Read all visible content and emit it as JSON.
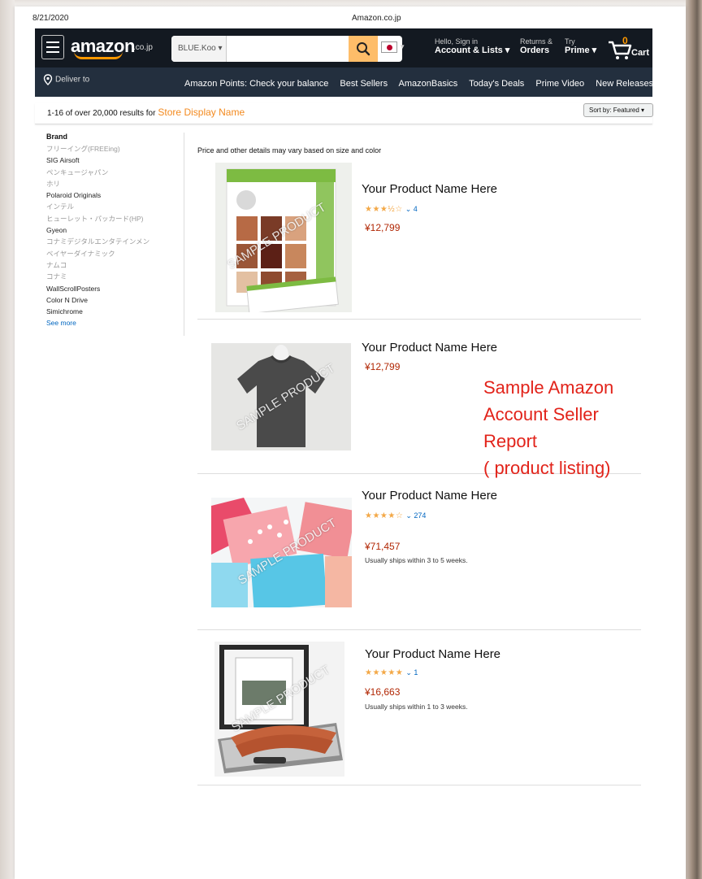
{
  "print_header": {
    "date": "8/21/2020",
    "title": "Amazon.co.jp"
  },
  "nav": {
    "logo": "amazon",
    "logo_tld": ".co.jp",
    "search_department": "BLUE.Koo ▾",
    "search_placeholder": "",
    "account_line1": "Hello, Sign in",
    "account_line2": "Account & Lists ▾",
    "orders_line1": "Returns &",
    "orders_line2": "Orders",
    "prime_line1": "Try",
    "prime_line2": "Prime ▾",
    "cart_count": "0",
    "cart_label": "Cart",
    "deliver_to": "Deliver to",
    "links": [
      "Amazon Points: Check your balance",
      "Best Sellers",
      "AmazonBasics",
      "Today's Deals",
      "Prime Video",
      "New Releases"
    ]
  },
  "results": {
    "summary": "1-16 of over 20,000 results for",
    "query": "Store Display Name",
    "sort_label": "Sort by: Featured ▾"
  },
  "sidebar": {
    "title": "Brand",
    "items": [
      {
        "label": "フリーイング(FREEing)",
        "tone": "light"
      },
      {
        "label": "SIG Airsoft",
        "tone": "dark"
      },
      {
        "label": "ペンキュージャパン",
        "tone": "light"
      },
      {
        "label": "ホリ",
        "tone": "light"
      },
      {
        "label": "Polaroid Originals",
        "tone": "dark"
      },
      {
        "label": "インテル",
        "tone": "light"
      },
      {
        "label": "ヒューレット・パッカード(HP)",
        "tone": "light"
      },
      {
        "label": "Gyeon",
        "tone": "dark"
      },
      {
        "label": "コナミデジタルエンタテインメン",
        "tone": "light"
      },
      {
        "label": "ベイヤーダイナミック",
        "tone": "light"
      },
      {
        "label": "ナムコ",
        "tone": "light"
      },
      {
        "label": "コナミ",
        "tone": "light"
      },
      {
        "label": "WallScrollPosters",
        "tone": "dark"
      },
      {
        "label": "Color N Drive",
        "tone": "dark"
      },
      {
        "label": "Simichrome",
        "tone": "dark"
      }
    ],
    "see_more": "See more"
  },
  "notice": "Price and other details may vary based on size and color",
  "watermark": "SAMPLE PRODUCT",
  "products": [
    {
      "name": "Your Product Name Here",
      "stars": "★★★½☆",
      "rating": 3.5,
      "reviews": "⌄ 4",
      "price": "¥12,799",
      "shipping": "",
      "image": "sample-display-board"
    },
    {
      "name": "Your Product Name Here",
      "stars": "",
      "rating": null,
      "reviews": "",
      "price": "¥12,799",
      "shipping": "",
      "image": "gray-tshirt"
    },
    {
      "name": "Your Product Name Here",
      "stars": "★★★★☆",
      "rating": 4,
      "reviews": "⌄ 274",
      "price": "¥71,457",
      "shipping": "Usually ships within 3 to 5 weeks.",
      "image": "pink-blue-boxes"
    },
    {
      "name": "Your Product Name Here",
      "stars": "★★★★★",
      "rating": 5,
      "reviews": "⌄ 1",
      "price": "¥16,663",
      "shipping": "Usually ships within 1 to 3 weeks.",
      "image": "tile-sample-case"
    }
  ],
  "report_note": [
    "Sample Amazon",
    "Account Seller",
    "Report",
    "( product listing)"
  ],
  "colors": {
    "nav_top": "#131921",
    "nav_bottom": "#232f3e",
    "search_button": "#febd69",
    "price": "#b12704",
    "query": "#f38a1f",
    "note": "#e2231a",
    "link": "#0066c0"
  }
}
